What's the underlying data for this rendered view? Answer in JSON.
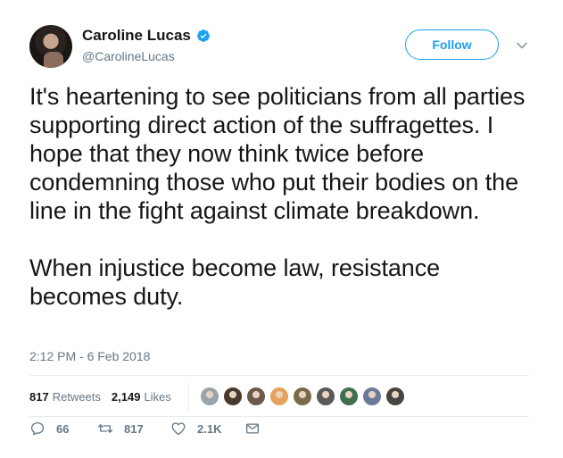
{
  "author": {
    "display_name": "Caroline Lucas",
    "handle": "@CarolineLucas",
    "verified": true
  },
  "follow_label": "Follow",
  "tweet": {
    "text": "It's heartening to see politicians from all parties supporting direct action of the suffragettes. I hope that they now think twice before condemning those who put their bodies on the line in the fight against climate breakdown.\n\nWhen injustice become law, resistance becomes duty.",
    "timestamp": "2:12 PM - 6 Feb 2018"
  },
  "stats": {
    "retweets_count": "817",
    "retweets_label": "Retweets",
    "likes_count": "2,149",
    "likes_label": "Likes"
  },
  "likers": [
    {
      "color": "#9aa4ad"
    },
    {
      "color": "#4a3a2e"
    },
    {
      "color": "#6b5a4a"
    },
    {
      "color": "#e6a15a"
    },
    {
      "color": "#7a6a4a"
    },
    {
      "color": "#5a5a5a"
    },
    {
      "color": "#3f6f4f"
    },
    {
      "color": "#6a7a9a"
    },
    {
      "color": "#4a4440"
    }
  ],
  "actions": {
    "replies": "66",
    "retweets": "817",
    "likes": "2.1K"
  },
  "colors": {
    "accent": "#1da1f2",
    "secondary_text": "#657786",
    "divider": "#e6ecf0"
  }
}
